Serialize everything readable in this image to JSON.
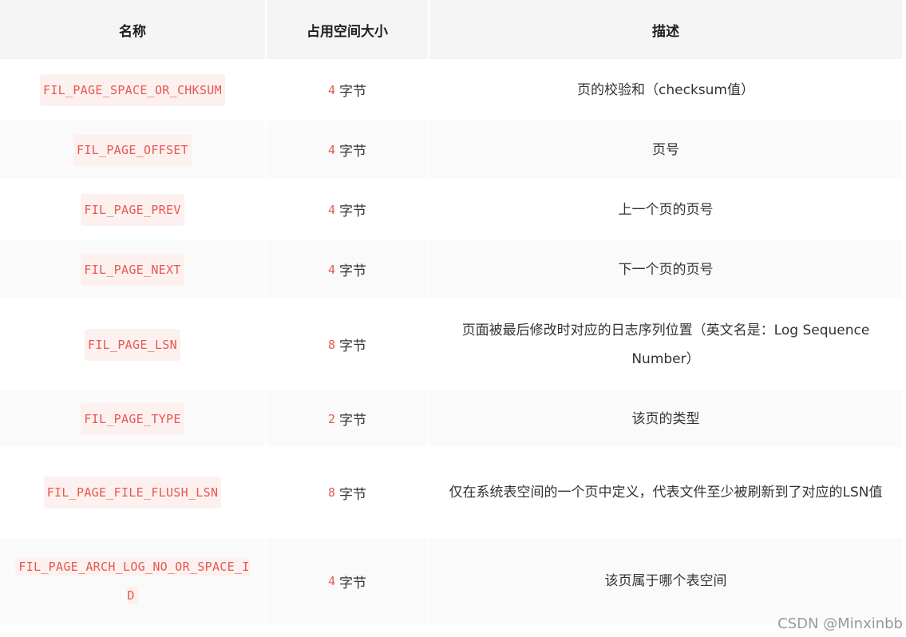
{
  "table": {
    "headers": [
      "名称",
      "占用空间大小",
      "描述"
    ],
    "rows": [
      {
        "name": "FIL_PAGE_SPACE_OR_CHKSUM",
        "size_num": "4",
        "size_unit": "字节",
        "desc": "页的校验和（checksum值）"
      },
      {
        "name": "FIL_PAGE_OFFSET",
        "size_num": "4",
        "size_unit": "字节",
        "desc": "页号"
      },
      {
        "name": "FIL_PAGE_PREV",
        "size_num": "4",
        "size_unit": "字节",
        "desc": "上一个页的页号"
      },
      {
        "name": "FIL_PAGE_NEXT",
        "size_num": "4",
        "size_unit": "字节",
        "desc": "下一个页的页号"
      },
      {
        "name": "FIL_PAGE_LSN",
        "size_num": "8",
        "size_unit": "字节",
        "desc": "页面被最后修改时对应的日志序列位置（英文名是：Log Sequence Number）"
      },
      {
        "name": "FIL_PAGE_TYPE",
        "size_num": "2",
        "size_unit": "字节",
        "desc": "该页的类型"
      },
      {
        "name": "FIL_PAGE_FILE_FLUSH_LSN",
        "size_num": "8",
        "size_unit": "字节",
        "desc": "仅在系统表空间的一个页中定义，代表文件至少被刷新到了对应的LSN值"
      },
      {
        "name": "FIL_PAGE_ARCH_LOG_NO_OR_SPACE_ID",
        "size_num": "4",
        "size_unit": "字节",
        "desc": "该页属于哪个表空间"
      }
    ]
  },
  "watermark": "CSDN @Minxinbb"
}
